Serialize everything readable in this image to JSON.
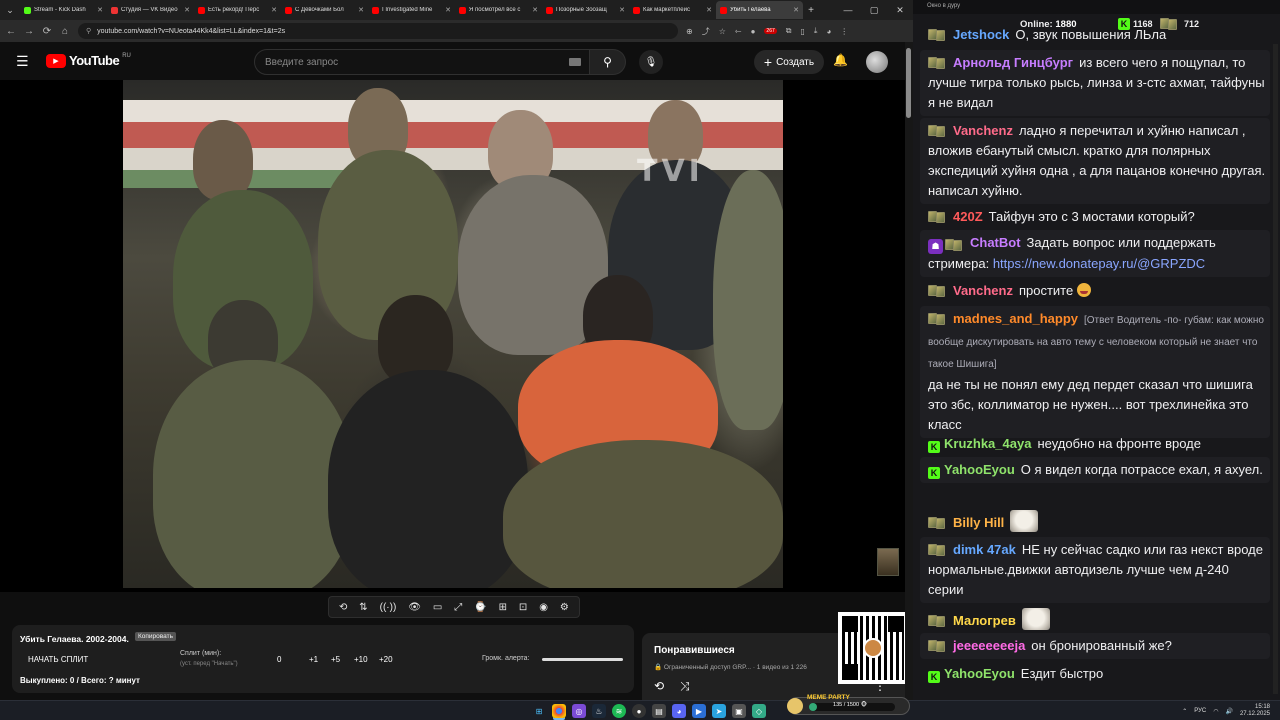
{
  "browser": {
    "tabs": [
      {
        "title": "Stream - Kick Dash",
        "color": "#53fc18"
      },
      {
        "title": "Студия — VK Видео",
        "color": "#e33"
      },
      {
        "title": "Есть рекорд! Перс",
        "color": "#ff0000"
      },
      {
        "title": "С Девочками Бол",
        "color": "#ff0000"
      },
      {
        "title": "I Investigated Mine",
        "color": "#ff0000"
      },
      {
        "title": "Я посмотрел все с",
        "color": "#ff0000"
      },
      {
        "title": "Позорные Зоозащ",
        "color": "#ff0000"
      },
      {
        "title": "Как маркетплейс",
        "color": "#ff0000"
      },
      {
        "title": "Убить Гелаева",
        "color": "#ff0000"
      }
    ],
    "url": "youtube.com/watch?v=NUeota44Kk4&list=LL&index=1&t=2s",
    "ext_badge": "267"
  },
  "youtube": {
    "logo_text": "YouTube",
    "country": "RU",
    "search_placeholder": "Введите запрос",
    "create_label": "Создать"
  },
  "video": {
    "watermark": "TVI"
  },
  "toolbar": {
    "icons": [
      "⟲",
      "⇅",
      "((·))",
      "👁",
      "▭",
      "⤢",
      "⌚",
      "⊞",
      "⊡",
      "◉",
      "⚙"
    ]
  },
  "split": {
    "title": "Убить Гелаева. 2002-2004.",
    "copy_label": "Копировать",
    "start_label": "НАЧАТЬ СПЛИТ",
    "split_label": "Сплит (мин):",
    "split_hint": "(уст. перед \"Начать\")",
    "value": "0",
    "buttons": [
      "+1",
      "+5",
      "+10",
      "+20"
    ],
    "alert_label": "Громк. алерта:",
    "status": "Выкуплено: 0 / Всего: ? минут"
  },
  "playlist": {
    "title": "Понравившиеся",
    "sub": "🔒 Ограниченный доступ GRP... · 1 видео из 1 226"
  },
  "chat": {
    "window_title": "Окно в дуру",
    "online_label": "Online:",
    "online_value": "1880",
    "kick_count": "1168",
    "badge_count": "712",
    "colors": {
      "purple": "#b689ff",
      "pink": "#ff5d8f",
      "red": "#ff4b4b",
      "blue": "#66a8ff",
      "green": "#8fe36b",
      "orange": "#ffb347",
      "yellow": "#ffd84a",
      "magenta": "#ff6be6"
    },
    "messages": [
      {
        "user": "Jetshock",
        "color": "#66a8ff",
        "text": "О, звук повышения ЛЬла"
      },
      {
        "user": "Арнольд Гинцбург",
        "color": "#c77dff",
        "text": "из всего чего я пощупал, то лучше тигра только рысь, линза и з-стс ахмат, тайфуны я не видал"
      },
      {
        "user": "Vanchenz",
        "color": "#ff6b8a",
        "text": "ладно я перечитал и хуйню написал , вложив ебанутый смысл. кратко для полярных экспедиций хуйня одна , а для пацанов конечно другая. написал хуйню."
      },
      {
        "user": "420Z",
        "color": "#ff5a5a",
        "text": "Тайфун это с 3 мостами который?"
      },
      {
        "user": "ChatBot",
        "color": "#c77dff",
        "text": "Задать вопрос или поддержать стримера:",
        "link": "https://new.donatepay.ru/@GRPZDC"
      },
      {
        "user": "Vanchenz",
        "color": "#ff6b8a",
        "text": "простите"
      },
      {
        "user": "madnes_and_happy",
        "color": "#ff8a2a",
        "reply": "[Ответ Водитель -по- губам: как можно вообще дискутировать на авто тему с человеком который не знает что такое Шишига]",
        "text": "да не ты не понял ему дед пердет сказал что шишига это збс, коллиматор не нужен.... вот трехлинейка это класс"
      },
      {
        "user": "Kruzhka_4aya",
        "color": "#8fe36b",
        "text": "неудобно на фронте вроде"
      },
      {
        "user": "YahooEyou",
        "color": "#8fe36b",
        "text": "О я видел когда потрассе ехал, я ахуел."
      },
      {
        "user": "Billy Hill",
        "color": "#ffb347",
        "text": ""
      },
      {
        "user": "dimk 47ak",
        "color": "#66a8ff",
        "text": "НЕ ну сейчас садко или газ некст вроде нормальные.движки автодизель лучше чем д-240 серии"
      },
      {
        "user": "Малогрев",
        "color": "#ffd84a",
        "text": ""
      },
      {
        "user": "jeeeeeeeeja",
        "color": "#ff6be6",
        "text": "он бронированный же?"
      },
      {
        "user": "YahooEyou",
        "color": "#8fe36b",
        "text": "Ездит быстро"
      }
    ]
  },
  "taskbar": {
    "meme_label": "MEME PARTY",
    "meme_text": "135 / 1500 🐵",
    "meme_progress": 0.09,
    "lang": "РУС",
    "time": "15:18",
    "date": "27.12.2025"
  }
}
